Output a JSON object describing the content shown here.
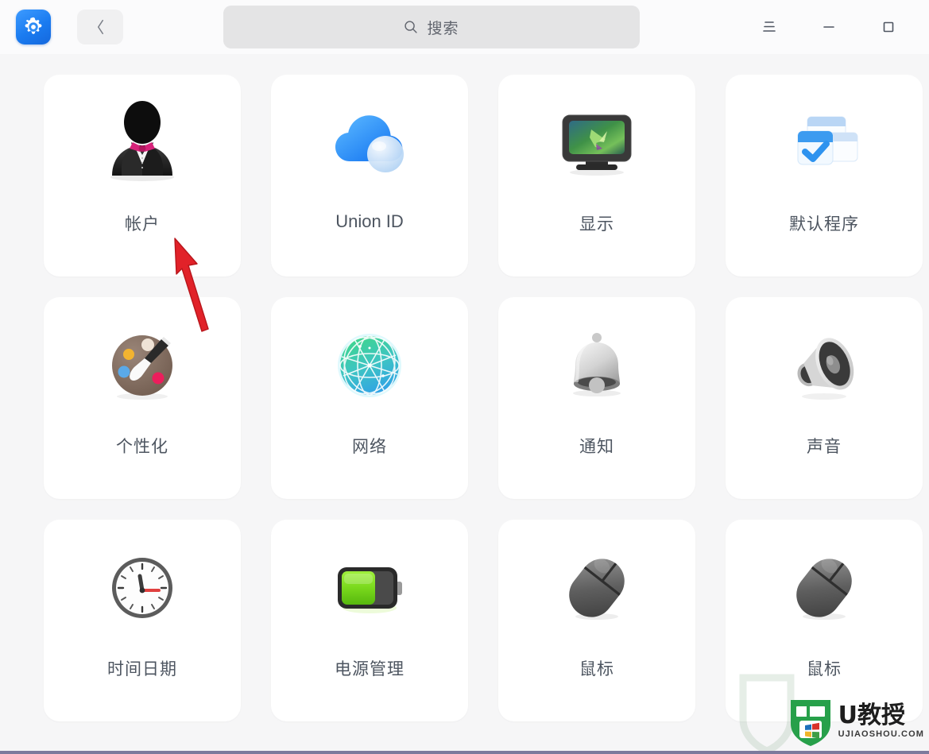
{
  "window": {
    "app_icon": "settings-gear-icon",
    "back_icon": "chevron-left-icon",
    "menu_icon": "hamburger-menu-icon",
    "minimize_icon": "minimize-icon",
    "maximize_icon": "maximize-icon",
    "menu_label": "菜单",
    "minimize_label": "最小化",
    "maximize_label": "最大化",
    "back_label": "返回"
  },
  "search": {
    "icon": "search-icon",
    "placeholder": "搜索",
    "value": ""
  },
  "grid": {
    "tiles": [
      {
        "id": "account",
        "label": "帐户",
        "icon": "user-tuxedo-icon",
        "latin": false
      },
      {
        "id": "union-id",
        "label": "Union ID",
        "icon": "cloud-account-icon",
        "latin": true
      },
      {
        "id": "display",
        "label": "显示",
        "icon": "monitor-icon",
        "latin": false
      },
      {
        "id": "default-apps",
        "label": "默认程序",
        "icon": "default-apps-icon",
        "latin": false
      },
      {
        "id": "personalization",
        "label": "个性化",
        "icon": "palette-brush-icon",
        "latin": false
      },
      {
        "id": "network",
        "label": "网络",
        "icon": "globe-network-icon",
        "latin": false
      },
      {
        "id": "notification",
        "label": "通知",
        "icon": "bell-icon",
        "latin": false
      },
      {
        "id": "sound",
        "label": "声音",
        "icon": "speaker-icon",
        "latin": false
      },
      {
        "id": "datetime",
        "label": "时间日期",
        "icon": "clock-icon",
        "latin": false
      },
      {
        "id": "power",
        "label": "电源管理",
        "icon": "battery-icon",
        "latin": false
      },
      {
        "id": "mouse",
        "label": "鼠标",
        "icon": "mouse-icon",
        "latin": false
      },
      {
        "id": "mouse-2",
        "label": "鼠标",
        "icon": "mouse-icon",
        "latin": false
      }
    ]
  },
  "annotation": {
    "arrow": "red-pointer-arrow",
    "color": "#e12229"
  },
  "watermark": {
    "brand": "U教授",
    "domain": "UJIAOSHOU.COM",
    "shield_color": "#27a04a"
  },
  "colors": {
    "accent": "#1a7bf0",
    "page_background": "#f6f6f7",
    "tile_background": "#ffffff",
    "label_text": "#4d5560",
    "searchbar_background": "#e4e4e5"
  }
}
